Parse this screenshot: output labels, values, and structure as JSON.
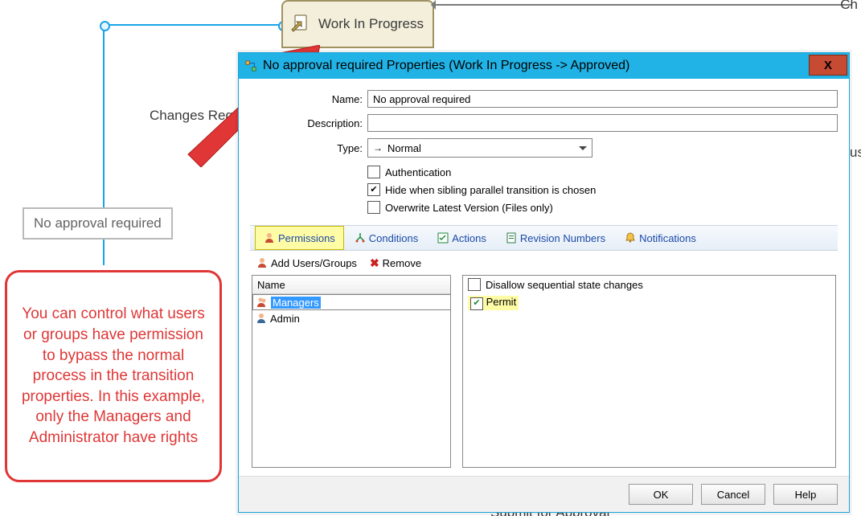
{
  "workflow": {
    "state_label": "Work In Progress",
    "ch_label": "Ch",
    "us_label": "us",
    "changes_req": "Changes Req",
    "transition_label": "No approval required",
    "submit_label": "Submit for Approval"
  },
  "callout": {
    "text": "You can control what users or groups have permission to bypass the normal process in the transition properties. In this example, only the Managers and Administrator have rights"
  },
  "dialog": {
    "title": "No approval required Properties (Work In Progress -> Approved)",
    "name_label": "Name:",
    "name_value": "No approval required",
    "desc_label": "Description:",
    "desc_value": "",
    "type_label": "Type:",
    "type_value": "Normal",
    "chk_auth": "Authentication",
    "chk_hide": "Hide when sibling parallel transition is chosen",
    "chk_overwrite": "Overwrite Latest Version (Files only)"
  },
  "tabs": {
    "permissions": "Permissions",
    "conditions": "Conditions",
    "actions": "Actions",
    "revision": "Revision Numbers",
    "notifications": "Notifications"
  },
  "toolbar": {
    "add": "Add Users/Groups",
    "remove": "Remove"
  },
  "userlist": {
    "header": "Name",
    "items": [
      {
        "label": "Managers",
        "selected": true,
        "icon": "group"
      },
      {
        "label": "Admin",
        "selected": false,
        "icon": "user"
      }
    ]
  },
  "rights": {
    "disallow": "Disallow sequential state changes",
    "permit": "Permit"
  },
  "buttons": {
    "ok": "OK",
    "cancel": "Cancel",
    "help": "Help"
  }
}
